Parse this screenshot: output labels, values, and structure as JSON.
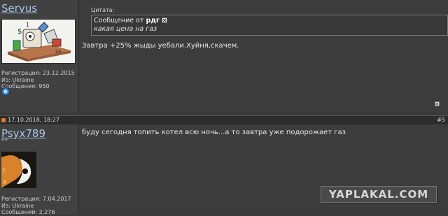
{
  "post1": {
    "username": "Servus",
    "meta": {
      "registration": "Регистрация: 23.12.2015",
      "from": "Из: Ukraine",
      "messages": "Сообщения: 950"
    },
    "quote": {
      "label": "Цитата:",
      "prefix": "Сообщение от",
      "author": "рдг",
      "text": "какая цена на газ"
    },
    "message": "Завтра +25% жыды уебали.Хуйня,скачем."
  },
  "post2": {
    "date": "17.10.2018, 18:27",
    "number": "#5",
    "username": "Psyx789",
    "stars": "**",
    "meta": {
      "registration": "Регистрация: 7.04.2017",
      "from": "Из: Ukraine",
      "messages": "Сообщений: 2,276"
    },
    "message": "буду сегодня топить котел всю ночь...а то завтра уже подорожает газ"
  },
  "watermark": "YAPLAKAL.COM"
}
